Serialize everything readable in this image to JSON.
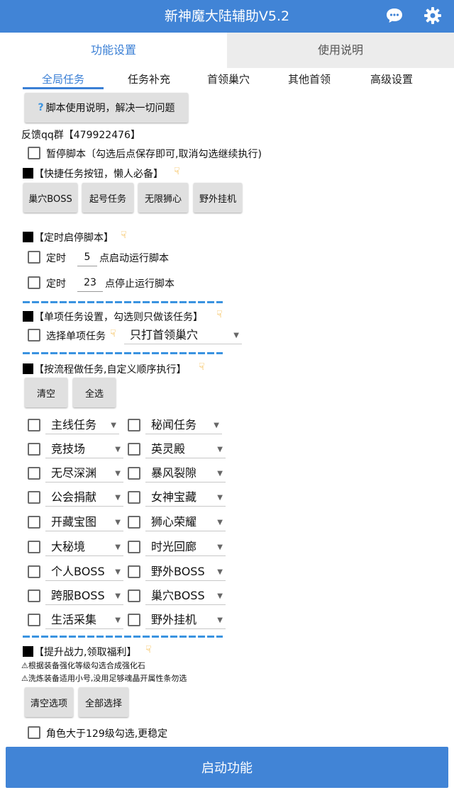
{
  "app": {
    "title": "新神魔大陆辅助V5.2",
    "chat_icon": "chat-bubble-icon",
    "settings_icon": "gear-icon"
  },
  "main_tabs": [
    {
      "label": "功能设置",
      "active": true
    },
    {
      "label": "使用说明",
      "active": false
    }
  ],
  "sub_tabs": [
    {
      "label": "全局任务",
      "active": true
    },
    {
      "label": "任务补充",
      "active": false
    },
    {
      "label": "首领巢穴",
      "active": false
    },
    {
      "label": "其他首领",
      "active": false
    },
    {
      "label": "高级设置",
      "active": false
    }
  ],
  "help_button": {
    "icon": "question-icon",
    "label": "脚本使用说明，解决一切问题"
  },
  "feedback_text": "反馈qq群【479922476】",
  "pause": {
    "label": "暂停脚本〔勾选后点保存即可,取消勾选继续执行)",
    "checked": false
  },
  "quick_section": {
    "heading": "【快捷任务按钮，懒人必备】",
    "buttons": [
      "巢穴BOSS",
      "起号任务",
      "无限狮心",
      "野外挂机"
    ]
  },
  "timer_section": {
    "heading": "【定时启停脚本】",
    "start": {
      "prefix": "定时",
      "value": "5",
      "suffix": "点启动运行脚本",
      "checked": false
    },
    "stop": {
      "prefix": "定时",
      "value": "23",
      "suffix": "点停止运行脚本",
      "checked": false
    }
  },
  "single_section": {
    "heading": "【单项任务设置，勾选则只做该任务】",
    "checkbox_label": "选择单项任务",
    "checked": false,
    "selected": "只打首领巢穴"
  },
  "flow_section": {
    "heading": "【按流程做任务,自定义顺序执行】",
    "clear_label": "清空",
    "select_all_label": "全选",
    "tasks": [
      [
        "主线任务",
        "秘闻任务"
      ],
      [
        "竞技场",
        "英灵殿"
      ],
      [
        "无尽深渊",
        "暴风裂隙"
      ],
      [
        "公会捐献",
        "女神宝藏"
      ],
      [
        "开藏宝图",
        "狮心荣耀"
      ],
      [
        "大秘境",
        "时光回廊"
      ],
      [
        "个人BOSS",
        "野外BOSS"
      ],
      [
        "跨服BOSS",
        "巢穴BOSS"
      ],
      [
        "生活采集",
        "野外挂机"
      ]
    ]
  },
  "power_section": {
    "heading": "【提升战力,领取福利】",
    "warn1": "⚠根据装备强化等级勾选合成强化石",
    "warn2": "⚠洗炼装备适用小号,没用足够魂晶开属性条勿选",
    "clear_label": "清空选项",
    "select_all_label": "全部选择",
    "level_label": "角色大于129级勾选,更稳定",
    "level_checked": false
  },
  "start_button": "启动功能",
  "colors": {
    "primary": "#4184d6",
    "accent_text": "#3a7fd5",
    "hand": "#f2a81c"
  }
}
